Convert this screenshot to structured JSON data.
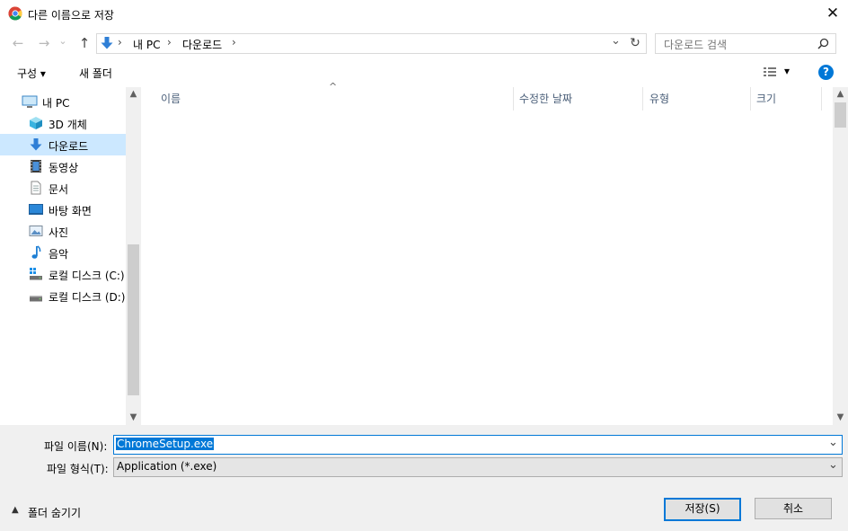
{
  "window": {
    "title": "다른 이름으로 저장",
    "close_symbol": "✕"
  },
  "nav_buttons": {
    "back": "←",
    "forward": "→",
    "recent": "⌄",
    "up": "↑",
    "refresh": "↻"
  },
  "address": {
    "root_chevron": "›",
    "crumbs": [
      "내 PC",
      "다운로드"
    ],
    "separator": "›",
    "dropdown": "⌄"
  },
  "search": {
    "placeholder": "다운로드 검색"
  },
  "toolbar": {
    "organize": "구성 ▾",
    "new_folder": "새 폴더",
    "view_dropdown": "▾",
    "help": "?"
  },
  "sidebar": {
    "items": [
      {
        "label": "내 PC",
        "icon": "pc-icon"
      },
      {
        "label": "3D 개체",
        "icon": "cube-icon"
      },
      {
        "label": "다운로드",
        "icon": "download-arrow-icon",
        "selected": true
      },
      {
        "label": "동영상",
        "icon": "video-icon"
      },
      {
        "label": "문서",
        "icon": "document-icon"
      },
      {
        "label": "바탕 화면",
        "icon": "desktop-icon"
      },
      {
        "label": "사진",
        "icon": "picture-icon"
      },
      {
        "label": "음악",
        "icon": "music-note-icon"
      },
      {
        "label": "로컬 디스크 (C:)",
        "icon": "drive-c-icon"
      },
      {
        "label": "로컬 디스크 (D:)",
        "icon": "drive-d-icon"
      }
    ]
  },
  "columns": {
    "name": "이름",
    "modified": "수정한 날짜",
    "type": "유형",
    "size": "크기",
    "sort_indicator": "^"
  },
  "bottom": {
    "filename_label": "파일 이름(N):",
    "filename_value": "ChromeSetup.exe",
    "filetype_label": "파일 형식(T):",
    "filetype_value": "Application (*.exe)",
    "hide_folders": "폴더 숨기기",
    "save_button": "저장(S)",
    "cancel_button": "취소"
  },
  "colors": {
    "accent": "#0078d7",
    "selected_bg": "#cce8ff",
    "panel_bg": "#f0f0f0"
  }
}
